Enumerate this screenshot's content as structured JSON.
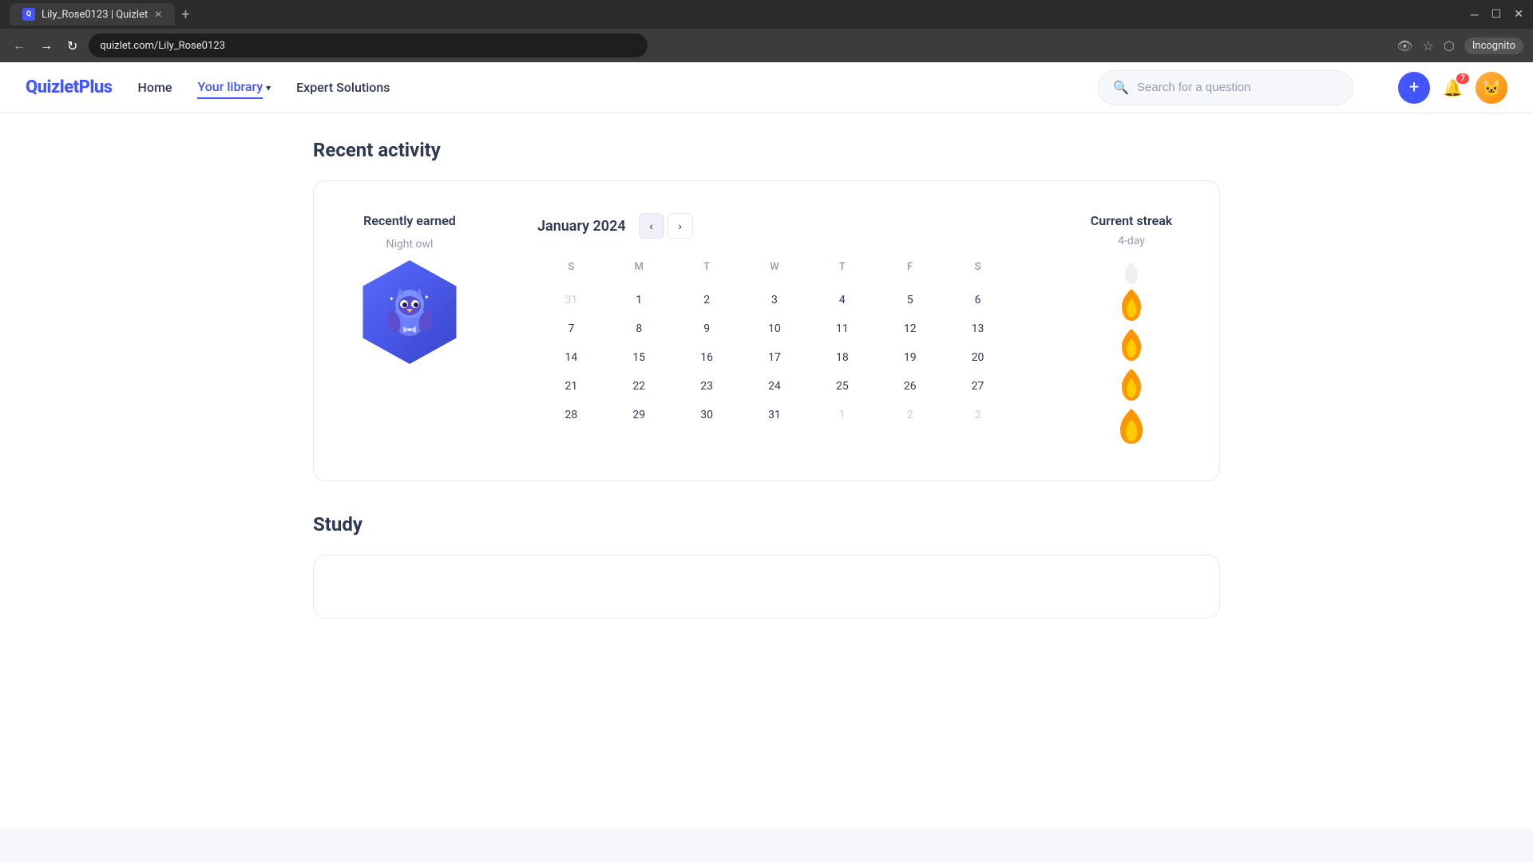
{
  "browser": {
    "tab_title": "Lily_Rose0123 | Quizlet",
    "url": "quizlet.com/Lily_Rose0123",
    "incognito_label": "Incognito"
  },
  "nav": {
    "logo": "QuizletPlus",
    "home_label": "Home",
    "your_library_label": "Your library",
    "expert_solutions_label": "Expert Solutions",
    "search_placeholder": "Search for a question",
    "bell_badge": "7"
  },
  "recent_activity": {
    "section_title": "Recent activity",
    "recently_earned_title": "Recently earned",
    "badge_name": "Night owl",
    "calendar_month": "January 2024",
    "calendar_days": [
      "S",
      "M",
      "T",
      "W",
      "T",
      "F",
      "S"
    ],
    "calendar_weeks": [
      [
        "31",
        "1",
        "2",
        "3",
        "4",
        "5",
        "6"
      ],
      [
        "7",
        "8",
        "9",
        "10",
        "11",
        "12",
        "13"
      ],
      [
        "14",
        "15",
        "16",
        "17",
        "18",
        "19",
        "20"
      ],
      [
        "21",
        "22",
        "23",
        "24",
        "25",
        "26",
        "27"
      ],
      [
        "28",
        "29",
        "30",
        "31",
        "1",
        "2",
        "3"
      ]
    ],
    "calendar_other_month_first_week": [
      true,
      false,
      false,
      false,
      false,
      false,
      false
    ],
    "calendar_other_month_last_week": [
      false,
      false,
      false,
      false,
      true,
      true,
      true
    ],
    "streak_title": "Current streak",
    "streak_label": "4-day",
    "streak_flames": 4,
    "streak_total": 5
  },
  "study": {
    "section_title": "Study"
  }
}
